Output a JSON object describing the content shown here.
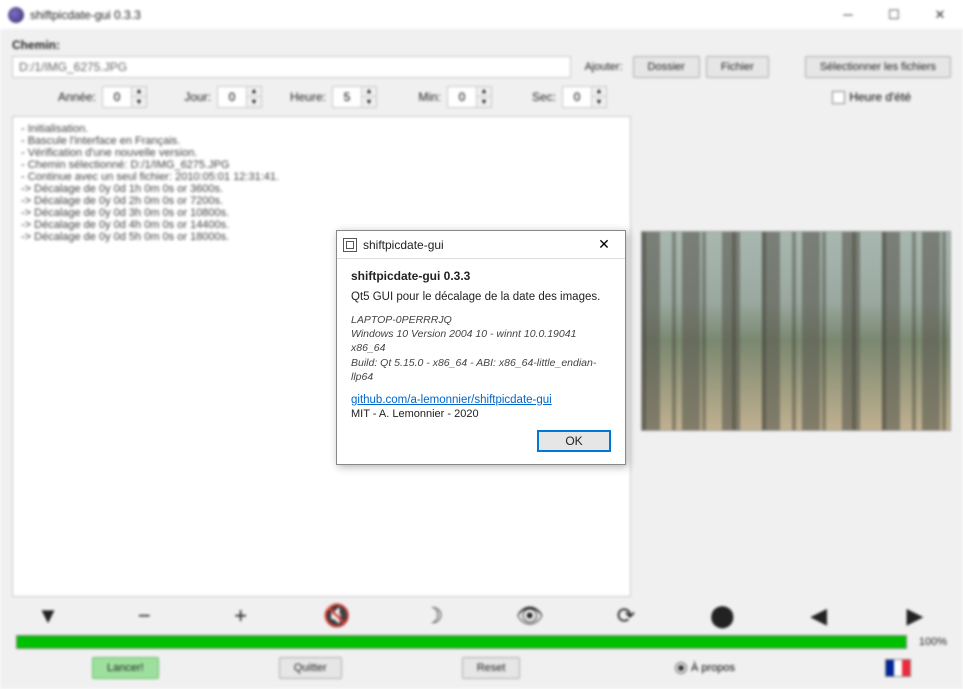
{
  "window": {
    "title": "shiftpicdate-gui 0.3.3"
  },
  "path": {
    "label": "Chemin:",
    "value": "D:/1/IMG_6275.JPG",
    "ajouter_label": "Ajouter:",
    "dossier": "Dossier",
    "fichier": "Fichier",
    "selection": "Sélectionner les fichiers"
  },
  "spinners": {
    "annee": {
      "label": "Année:",
      "value": "0"
    },
    "jour": {
      "label": "Jour:",
      "value": "0"
    },
    "heure": {
      "label": "Heure:",
      "value": "5"
    },
    "min": {
      "label": "Min:",
      "value": "0"
    },
    "sec": {
      "label": "Sec:",
      "value": "0"
    },
    "heure_ete": "Heure d'été"
  },
  "log": "- Initialisation.\n- Bascule l'interface en Français.\n- Vérification d'une nouvelle version.\n- Chemin sélectionné: D:/1/IMG_6275.JPG\n- Continue avec un seul fichier: 2010:05:01 12:31:41.\n-> Décalage de 0y 0d 1h 0m 0s or 3600s.\n-> Décalage de 0y 0d 2h 0m 0s or 7200s.\n-> Décalage de 0y 0d 3h 0m 0s or 10800s.\n-> Décalage de 0y 0d 4h 0m 0s or 14400s.\n-> Décalage de 0y 0d 5h 0m 0s or 18000s.",
  "progress": {
    "percent": "100%"
  },
  "bottom": {
    "lancer": "Lancer!",
    "quitter": "Quitter",
    "reset": "Reset",
    "apropos": "À propos"
  },
  "dialog": {
    "title": "shiftpicdate-gui",
    "heading": "shiftpicdate-gui 0.3.3",
    "desc": "Qt5 GUI pour le décalage de la date des images.",
    "sys1": "LAPTOP-0PERRRJQ",
    "sys2": "Windows 10 Version 2004 10 - winnt 10.0.19041 x86_64",
    "sys3": "Build: Qt 5.15.0 - x86_64 - ABI: x86_64-little_endian-llp64",
    "link": "github.com/a-lemonnier/shiftpicdate-gui",
    "license": "MIT - A. Lemonnier - 2020",
    "ok": "OK"
  }
}
